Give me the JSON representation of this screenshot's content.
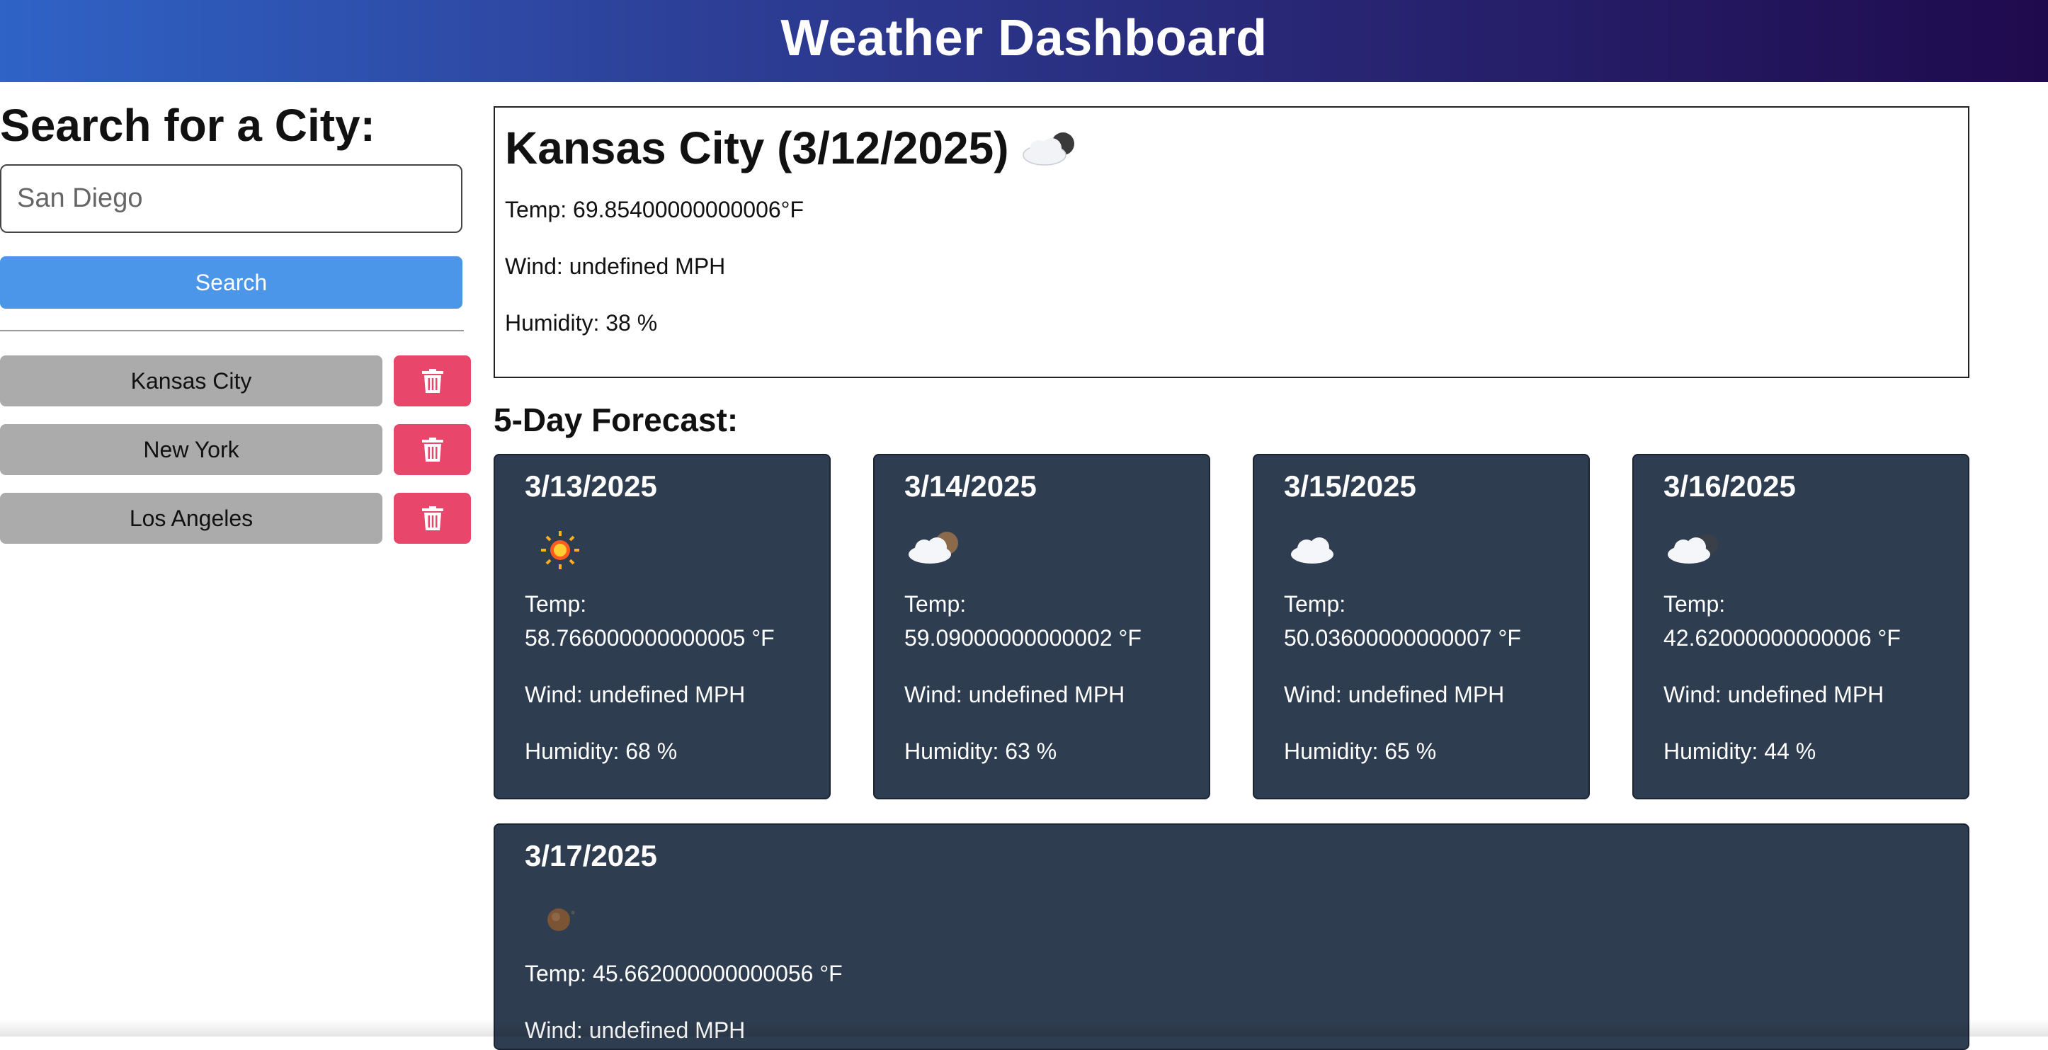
{
  "header": {
    "title": "Weather Dashboard"
  },
  "sidebar": {
    "search_title": "Search for a City:",
    "search_value": "San Diego",
    "search_button": "Search",
    "history": [
      {
        "label": "Kansas City"
      },
      {
        "label": "New York"
      },
      {
        "label": "Los Angeles"
      }
    ],
    "delete_icon": "trash-icon"
  },
  "current": {
    "title": "Kansas City (3/12/2025)",
    "icon": "cloud-moon-icon",
    "temp": "Temp: 69.85400000000006°F",
    "wind": "Wind: undefined MPH",
    "humidity": "Humidity: 38 %"
  },
  "forecast": {
    "title": "5-Day Forecast:",
    "days": [
      {
        "date": "3/13/2025",
        "icon": "sun-icon",
        "temp_label": "Temp:",
        "temp_value": "58.766000000000005 °F",
        "wind": "Wind: undefined MPH",
        "humidity": "Humidity: 68 %"
      },
      {
        "date": "3/14/2025",
        "icon": "cloud-moon-icon",
        "temp_label": "Temp:",
        "temp_value": "59.09000000000002 °F",
        "wind": "Wind: undefined MPH",
        "humidity": "Humidity: 63 %"
      },
      {
        "date": "3/15/2025",
        "icon": "cloud-icon",
        "temp_label": "Temp:",
        "temp_value": "50.03600000000007 °F",
        "wind": "Wind: undefined MPH",
        "humidity": "Humidity: 65 %"
      },
      {
        "date": "3/16/2025",
        "icon": "cloud-night-icon",
        "temp_label": "Temp:",
        "temp_value": "42.62000000000006 °F",
        "wind": "Wind: undefined MPH",
        "humidity": "Humidity: 44 %"
      },
      {
        "date": "3/17/2025",
        "icon": "moon-icon",
        "temp": "Temp: 45.662000000000056 °F",
        "wind": "Wind: undefined MPH"
      }
    ]
  },
  "colors": {
    "search_button": "#4b96e8",
    "history_button": "#ababab",
    "delete_button": "#e8466b",
    "card_bg": "#2e3d50"
  }
}
